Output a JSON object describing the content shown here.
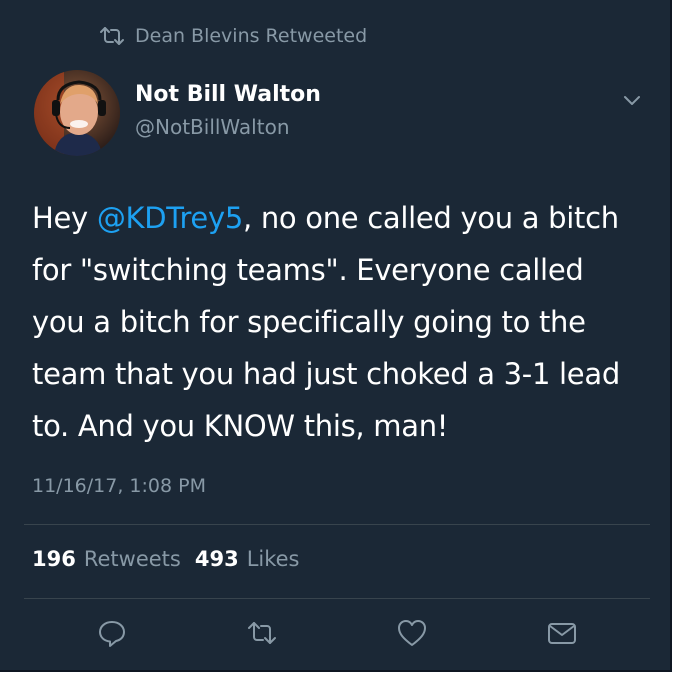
{
  "retweet_banner": {
    "text": "Dean Blevins Retweeted",
    "icon": "retweet-icon"
  },
  "author": {
    "display_name": "Not Bill Walton",
    "handle": "@NotBillWalton",
    "avatar": "avatar-photo"
  },
  "tweet": {
    "text_start": "Hey ",
    "mention": "@KDTrey5",
    "text_rest": ", no one called you a bitch for \"switching teams\". Everyone called you a bitch for specifically going to the team that you had just choked a 3-1 lead to. And you KNOW this, man!",
    "timestamp": "11/16/17, 1:08 PM"
  },
  "stats": {
    "retweets_count": "196",
    "retweets_label": "Retweets",
    "likes_count": "493",
    "likes_label": "Likes"
  },
  "actions": [
    {
      "icon": "reply-icon"
    },
    {
      "icon": "retweet-icon"
    },
    {
      "icon": "like-icon"
    },
    {
      "icon": "message-icon"
    }
  ],
  "colors": {
    "background": "#1b2836",
    "secondary_text": "#8899a6",
    "mention": "#1da1f2",
    "divider": "#38444d"
  }
}
